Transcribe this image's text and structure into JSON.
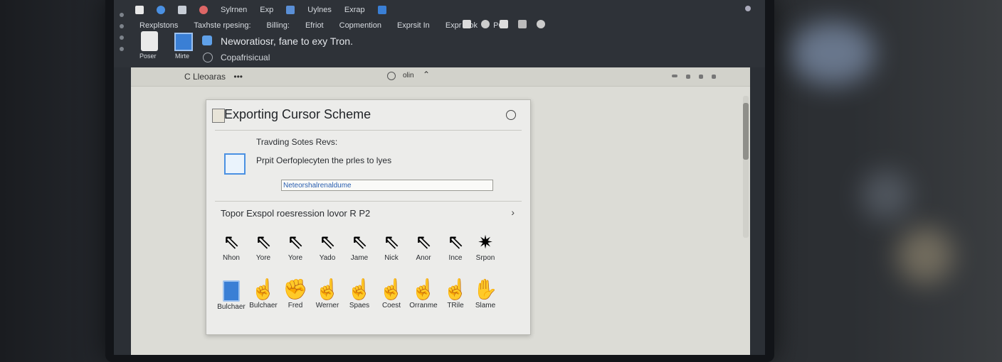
{
  "toolbar_top": {
    "label_a": "Sylrnen",
    "label_b": "Exp",
    "label_c": "Uylnes",
    "label_d": "Exrap"
  },
  "menu": {
    "items": [
      "Rexplstons",
      "Taxhste rpesing:",
      "Billing:",
      "Efriot",
      "Copmention",
      "Exprsit In",
      "Expr isok",
      "PC"
    ]
  },
  "toolbar_icons": [
    {
      "name": "power-icon",
      "label": "Poser"
    },
    {
      "name": "monitor-icon",
      "label": "Mirte"
    }
  ],
  "notification": {
    "main": "Neworatiosr, fane to exy Tron.",
    "sub": "Copafrisicual"
  },
  "breadcrumb": {
    "label": "Lleoaras",
    "more": "•••"
  },
  "subbar": {
    "text": "olin"
  },
  "panel": {
    "title": "Exporting Cursor Scheme",
    "section_label": "Travding Sotes Revs:",
    "description": "Prpit Oerfoplecyten the prles to lyes",
    "input_value": "Neteorshalrenaldume",
    "preview_heading": "Topor Exspol roesression lovor R P2"
  },
  "cursors_row1": [
    "Nhon",
    "Yore",
    "Yore",
    "Yado",
    "Jame",
    "Nick",
    "Anor",
    "Ince",
    "Srpon"
  ],
  "cursors_row2": [
    "Bulchaer",
    "Bulchaer",
    "Fred",
    "Werner",
    "Spaes",
    "Coest",
    "Orranme",
    "TRile",
    "Slame"
  ],
  "colors": {
    "toolbar_bg": "#2e3238",
    "workspace_bg": "#dcdcd6",
    "panel_bg": "#ececea",
    "accent_blue": "#3a7fd5"
  }
}
